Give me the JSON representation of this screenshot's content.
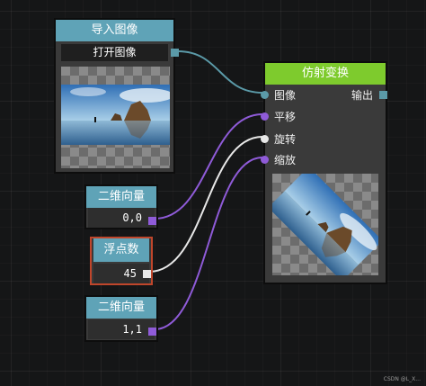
{
  "import_node": {
    "title": "导入图像",
    "open_button": "打开图像"
  },
  "affine_node": {
    "title": "仿射变换",
    "inputs": [
      "图像",
      "平移",
      "旋转",
      "缩放"
    ],
    "output": "输出"
  },
  "vec_node_1": {
    "title": "二维向量",
    "value": "0,0"
  },
  "float_node": {
    "title": "浮点数",
    "value": "45"
  },
  "vec_node_2": {
    "title": "二维向量",
    "value": "1,1"
  },
  "colors": {
    "image_pin": "#5b9aa8",
    "vector_pin": "#8f5bd8",
    "float_pin": "#e0e0e0",
    "blue_header": "#5fa3b7",
    "green_header": "#7ecb2d",
    "selected_border": "#c0462b"
  },
  "watermark": "CSDN @L_X..."
}
